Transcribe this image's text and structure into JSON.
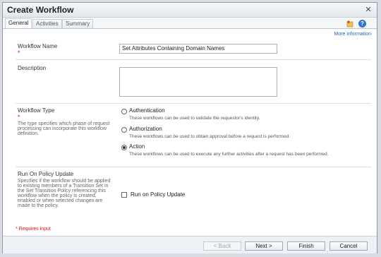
{
  "window": {
    "title": "Create Workflow",
    "close_label": "✕"
  },
  "tabs": [
    {
      "label": "General"
    },
    {
      "label": "Activities"
    },
    {
      "label": "Summary"
    }
  ],
  "toolbar": {
    "help_label": "?",
    "more_info": "More information"
  },
  "workflow_name": {
    "label": "Workflow Name",
    "required_mark": "*",
    "value": "Set Attributes Containing Domain Names"
  },
  "description": {
    "label": "Description"
  },
  "workflow_type": {
    "label": "Workflow Type",
    "required_mark": "*",
    "help": "The type specifies which phase of request processing can incorporate this workflow definition.",
    "options": [
      {
        "label": "Authentication",
        "desc": "These workflows can be used to validate the requestor's identity."
      },
      {
        "label": "Authorization",
        "desc": "These workflows can be used to obtain approval before a request is performed."
      },
      {
        "label": "Action",
        "desc": "These workflows can be used to execute any further activities after a request has been performed."
      }
    ],
    "selected_index": 2
  },
  "run_on_policy": {
    "label": "Run On Policy Update",
    "help": "Specifies if the workflow should be applied to existing members of a Transition Set in the Set Transition Policy referencing this workflow when the policy is created, enabled or when selected changes are made to the policy.",
    "checkbox_label": "Run on Policy Update"
  },
  "requires_input": "* Requires input",
  "buttons": {
    "back": "< Back",
    "next": "Next >",
    "finish": "Finish",
    "cancel": "Cancel"
  }
}
